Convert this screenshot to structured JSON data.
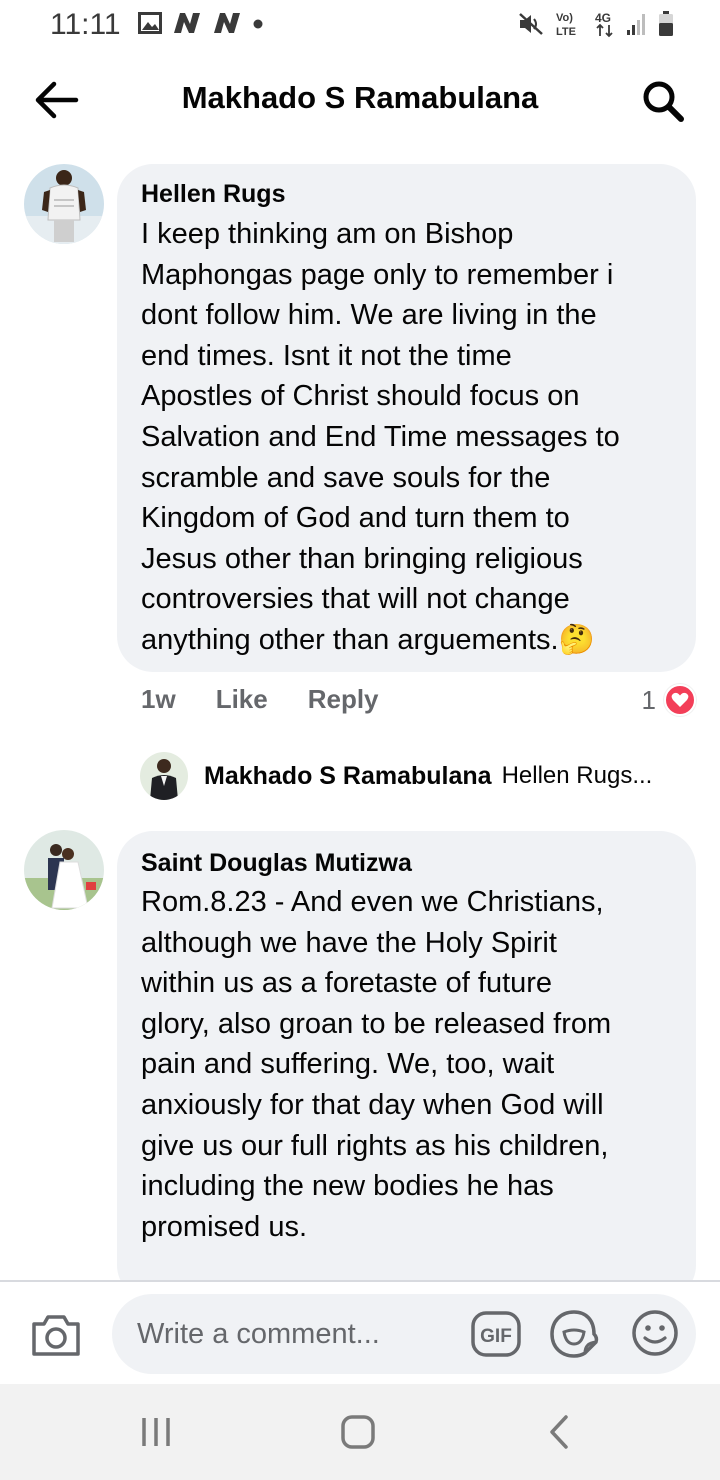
{
  "status_bar": {
    "time": "11:11",
    "left_icons": [
      "image-icon",
      "n-notification-icon",
      "n-notification-icon",
      "dot-icon"
    ],
    "right_icons": [
      "mute-icon",
      "volte-icon",
      "4g-icon",
      "signal-icon",
      "battery-icon"
    ],
    "volte_label": "Vo) LTE",
    "network_label": "4G"
  },
  "header": {
    "title": "Makhado S Ramabulana"
  },
  "comments": [
    {
      "author": "Hellen Rugs",
      "lines": [
        "I keep thinking am on Bishop",
        "Maphongas page only to remember i",
        "dont follow him. We are living in the",
        "end times. Isnt it not the time",
        "Apostles of Christ should focus on",
        "Salvation and End Time messages to",
        "scramble and save souls for the",
        "Kingdom of God and turn them to",
        "Jesus other than bringing religious",
        "controversies that will not change",
        "anything other than arguements."
      ],
      "emoji": "🤔",
      "time": "1w",
      "like_label": "Like",
      "reply_label": "Reply",
      "reaction_count": "1"
    },
    {
      "author": "Saint Douglas Mutizwa",
      "lines": [
        "Rom.8.23 - And even we Christians,",
        "although we have the Holy Spirit",
        "within us as a foretaste of future",
        "glory, also groan to be released from",
        "pain and suffering. We, too, wait",
        "anxiously for that day when God will",
        "give us our full rights as his children,",
        "including the new bodies he has",
        "promised us."
      ]
    }
  ],
  "reply_preview": {
    "name": "Makhado S Ramabulana",
    "snippet": "Hellen Rugs..."
  },
  "composer": {
    "placeholder": "Write a comment...",
    "gif_label": "GIF"
  },
  "colors": {
    "bubble": "#f0f2f5",
    "meta_text": "#65676b",
    "heart": "#f33e58"
  }
}
